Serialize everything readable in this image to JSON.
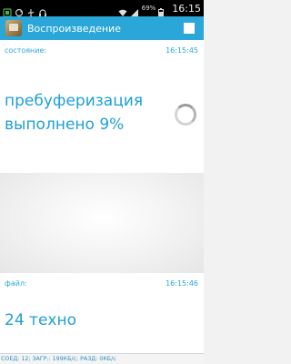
{
  "status_bar": {
    "battery_percent": "69%",
    "time": "16:15",
    "icons": [
      "apps-icon",
      "sync-icon",
      "usb-icon",
      "headset-icon",
      "wifi-icon",
      "signal-icon",
      "battery-icon"
    ]
  },
  "action_bar": {
    "title": "Воспроизведение",
    "app_icon": "radio-app-icon",
    "stop_icon": "stop-icon"
  },
  "state_section": {
    "label": "состояние:",
    "time": "16:15:45",
    "line1": "пребуферизация",
    "line2": "выполнено 9%",
    "progress_percent": 9
  },
  "file_section": {
    "label": "файл:",
    "time": "16:15:46",
    "value": "24 техно"
  },
  "footer": {
    "text": "СОЕД: 12; ЗАГР.: 199КБ/с; РАЗД: 0КБ/с"
  },
  "colors": {
    "accent": "#1e9fd6",
    "action_bar": "#2aa6d8"
  }
}
